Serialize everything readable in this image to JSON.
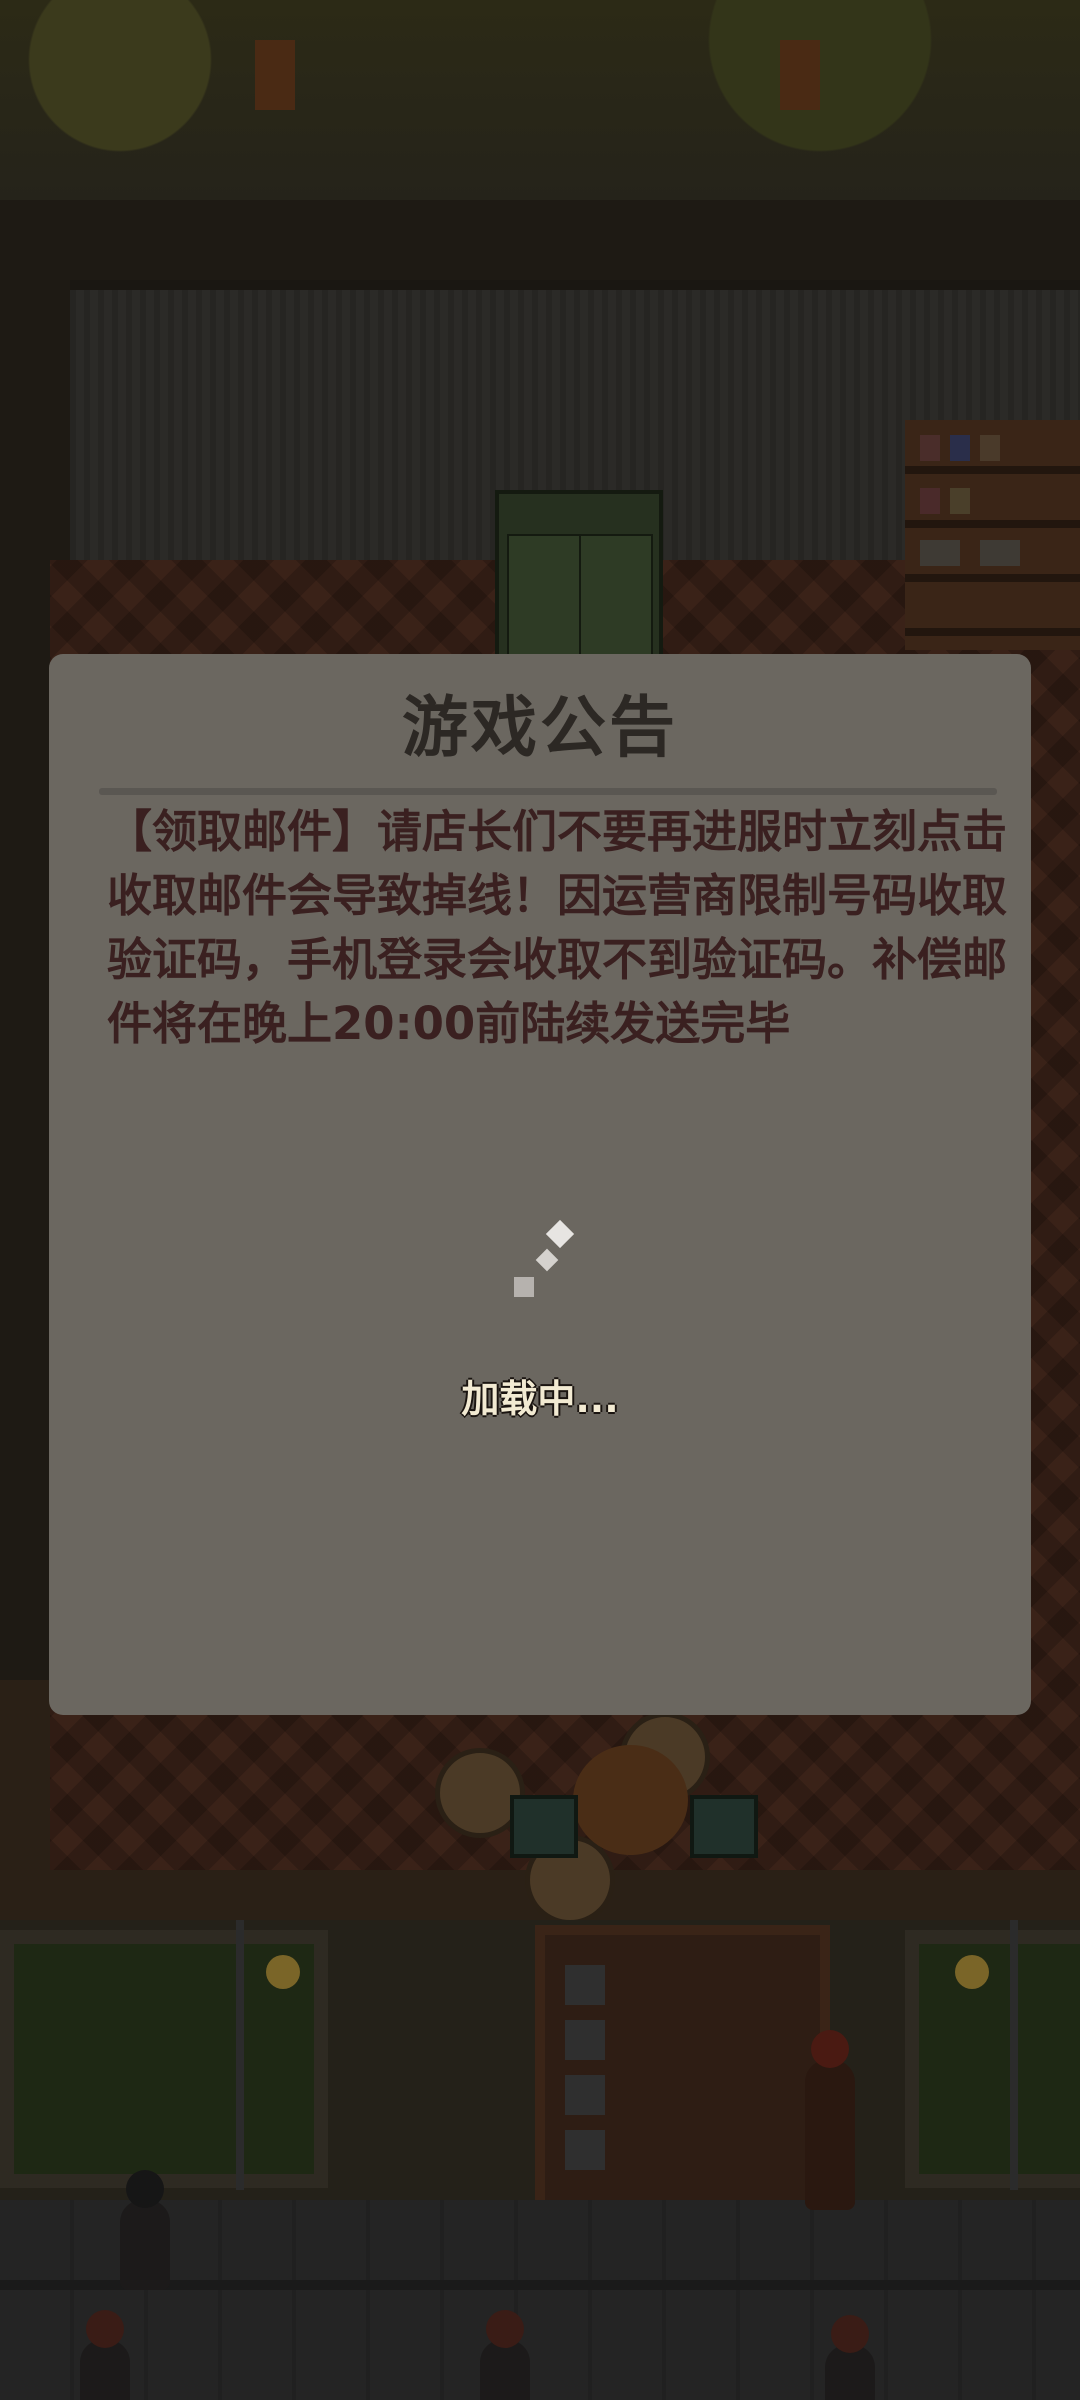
{
  "announcement": {
    "title": "游戏公告",
    "body": "【领取邮件】请店长们不要再进服时立刻点击收取邮件会导致掉线！因运营商限制号码收取验证码，手机登录会收取不到验证码。补偿邮件将在晚上20:00前陆续发送完毕"
  },
  "loading": {
    "label": "加载中..."
  },
  "colors": {
    "dialog_bg": "#6b6760",
    "title_text": "#2c2824",
    "body_text": "#3a2020",
    "loading_text": "#f2ead2"
  },
  "icons": {
    "spinner": "loading-spinner-icon"
  }
}
